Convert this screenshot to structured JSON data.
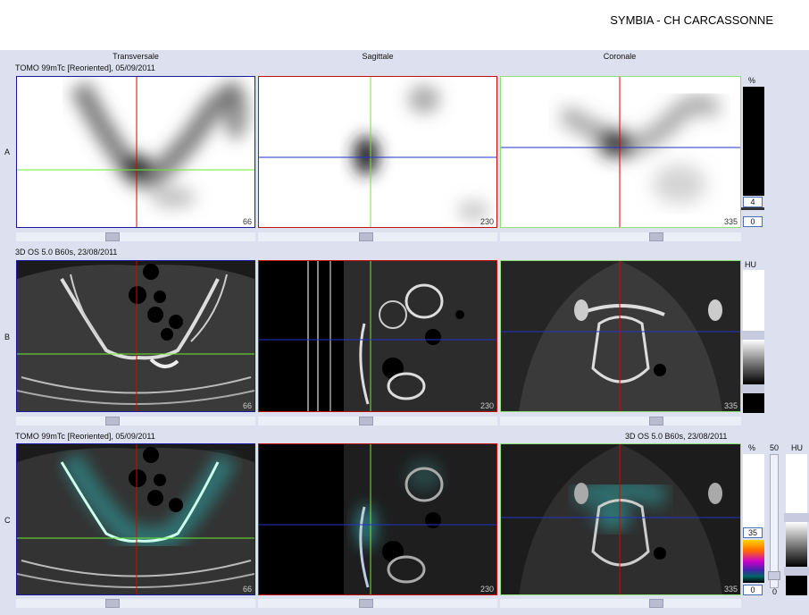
{
  "header": {
    "title": "SYMBIA - CH CARCASSONNE"
  },
  "columns": [
    "Transversale",
    "Sagittale",
    "Coronale"
  ],
  "rows": [
    {
      "letter": "A",
      "info_left": "TOMO 99mTc [Reoriented], 05/09/2011",
      "info_right": ""
    },
    {
      "letter": "B",
      "info_left": "3D  OS  5.0  B60s, 23/08/2011",
      "info_right": ""
    },
    {
      "letter": "C",
      "info_left": "TOMO 99mTc [Reoriented], 05/09/2011",
      "info_right": "3D  OS  5.0  B60s, 23/08/2011"
    }
  ],
  "slices": {
    "transversale": "66",
    "sagittale": "230",
    "coronale": "335"
  },
  "colorbars": {
    "a": {
      "unit": "%",
      "value": "4",
      "min": "0"
    },
    "b": {
      "unit": "HU"
    },
    "c": {
      "unit_pct": "%",
      "fifty": "50",
      "unit_hu": "HU",
      "value": "35",
      "min": "0",
      "zero": "0"
    }
  },
  "colors": {
    "crosshair_red": "#e00000",
    "crosshair_green": "#66ee33",
    "crosshair_blue": "#2233cc",
    "frame_blue": "#1a1aa0",
    "frame_red": "#c01010",
    "frame_green": "#8ee070",
    "panel_bg": "#dde0ee"
  }
}
